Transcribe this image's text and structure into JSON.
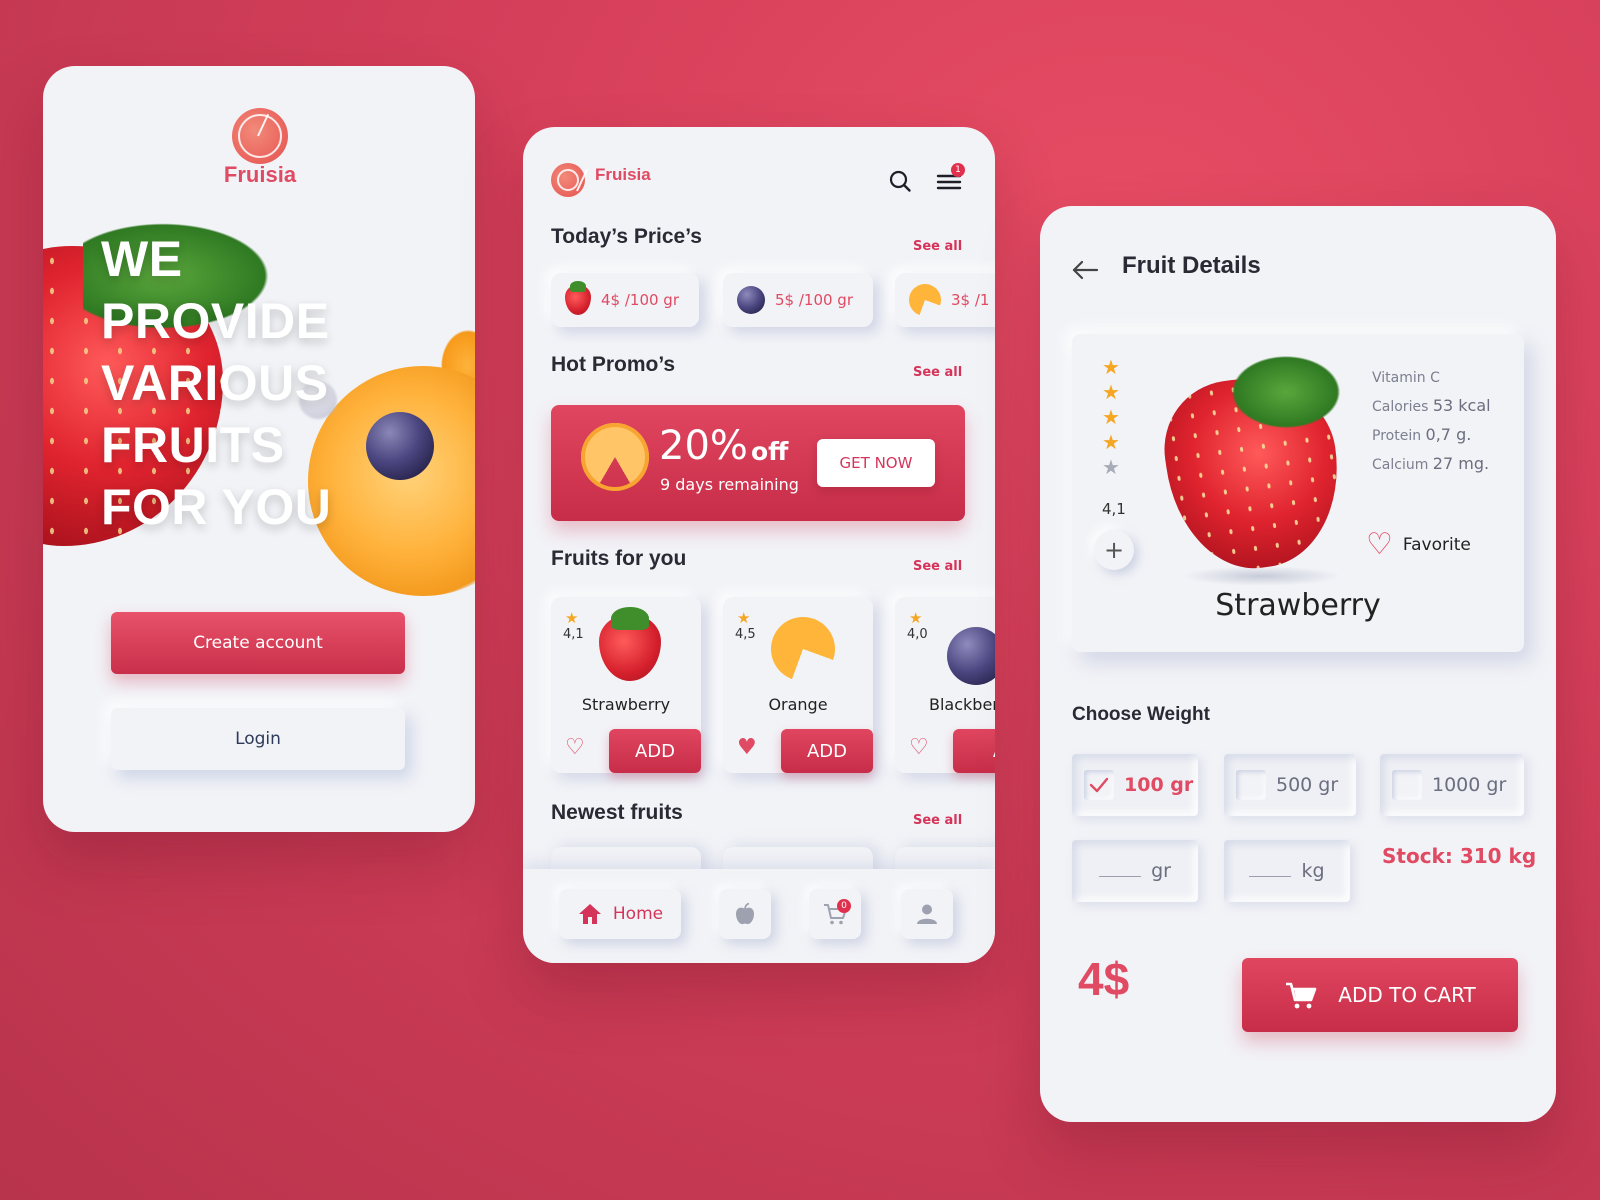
{
  "colors": {
    "background": "#d63f5a",
    "accent": "#e04a62",
    "card": "#f2f3f7",
    "star": "#f5a623"
  },
  "welcome": {
    "brand": "Fruisia",
    "hero_lines": [
      "WE",
      "PROVIDE",
      "VARIOUS",
      "FRUITS",
      "FOR YOU"
    ],
    "create_account_label": "Create account",
    "login_label": "Login"
  },
  "home": {
    "brand": "Fruisia",
    "menu_badge": "1",
    "todays_prices": {
      "title": "Today’s Price’s",
      "see_all": "See all",
      "items": [
        {
          "icon": "strawberry-icon",
          "price": "4$ /100 gr"
        },
        {
          "icon": "blackberry-icon",
          "price": "5$ /100 gr"
        },
        {
          "icon": "orange-icon",
          "price": "3$ /1"
        }
      ]
    },
    "hot_promos": {
      "title": "Hot Promo’s",
      "see_all": "See all",
      "percent": "20%",
      "off": "off",
      "remaining": "9 days remaining",
      "cta": "GET NOW"
    },
    "fruits_for_you": {
      "title": "Fruits for you",
      "see_all": "See all",
      "items": [
        {
          "name": "Strawberry",
          "rating": "4,1",
          "favorited": false,
          "add": "ADD"
        },
        {
          "name": "Orange",
          "rating": "4,5",
          "favorited": true,
          "add": "ADD"
        },
        {
          "name": "Blackber",
          "rating": "4,0",
          "favorited": false,
          "add": "A"
        }
      ]
    },
    "newest_fruits": {
      "title": "Newest fruits",
      "see_all": "See all"
    },
    "nav": {
      "home_label": "Home",
      "cart_count": "0"
    }
  },
  "details": {
    "title": "Fruit Details",
    "rating": "4,1",
    "stars": 4,
    "stars_max": 5,
    "name": "Strawberry",
    "nutrition": [
      {
        "label": "Vitamin C",
        "value": ""
      },
      {
        "label": "Calories",
        "value": "53 kcal"
      },
      {
        "label": "Protein",
        "value": "0,7 g."
      },
      {
        "label": "Calcium",
        "value": "27 mg."
      }
    ],
    "favorite_label": "Favorite",
    "choose_weight": "Choose Weight",
    "weights": [
      {
        "label": "100 gr",
        "selected": true
      },
      {
        "label": "500 gr",
        "selected": false
      },
      {
        "label": "1000 gr",
        "selected": false
      }
    ],
    "custom_units": [
      "gr",
      "kg"
    ],
    "stock_label": "Stock:",
    "stock_value": "310 kg",
    "price": "4$",
    "add_to_cart": "ADD TO CART"
  }
}
